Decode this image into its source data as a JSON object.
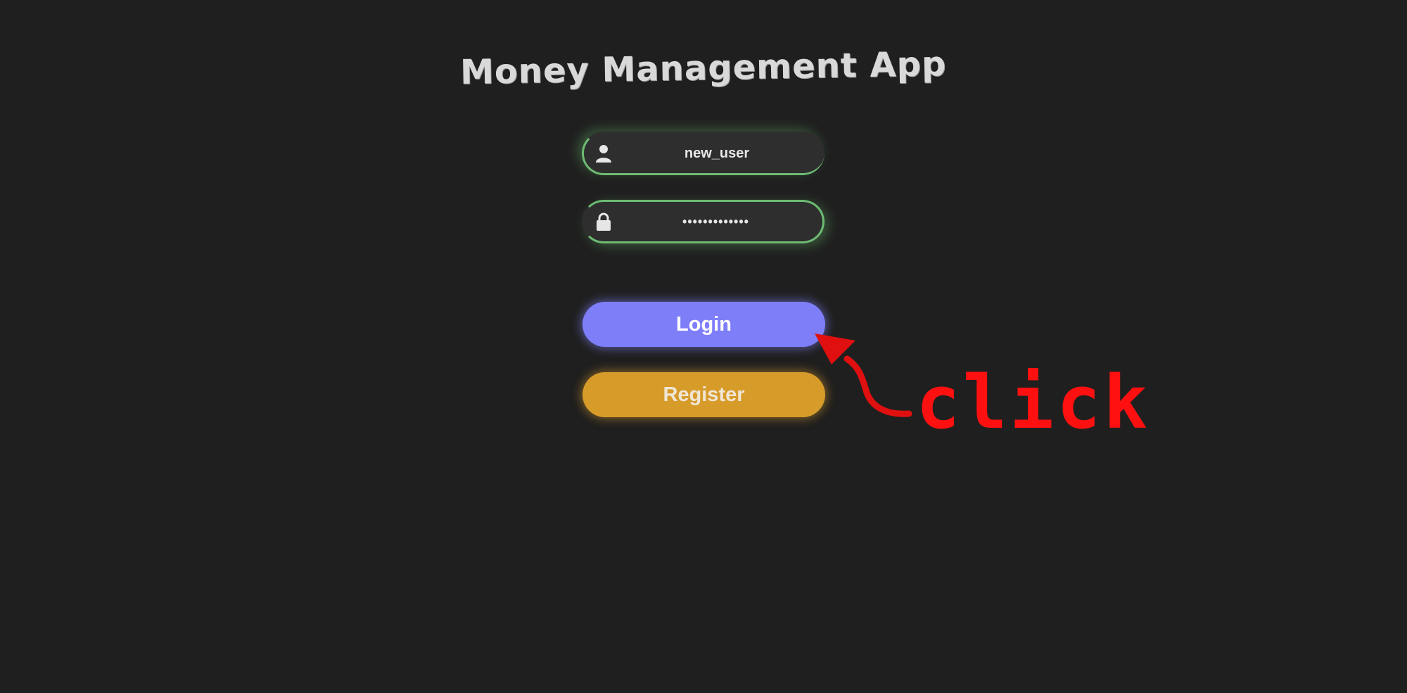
{
  "app": {
    "title": "Money Management App"
  },
  "login_form": {
    "username": {
      "value": "new_user",
      "icon": "user-icon"
    },
    "password": {
      "value": "•••••••••••••",
      "icon": "lock-icon"
    },
    "login_label": "Login",
    "register_label": "Register"
  },
  "annotation": {
    "text": "click",
    "color": "#ff1010"
  },
  "colors": {
    "background": "#1f1f1f",
    "field_background": "#2e2e2e",
    "field_glow": "#6dbb72",
    "login_button": "#7f7ef9",
    "register_button": "#d79b2a",
    "title_text": "#d9d9d9"
  }
}
